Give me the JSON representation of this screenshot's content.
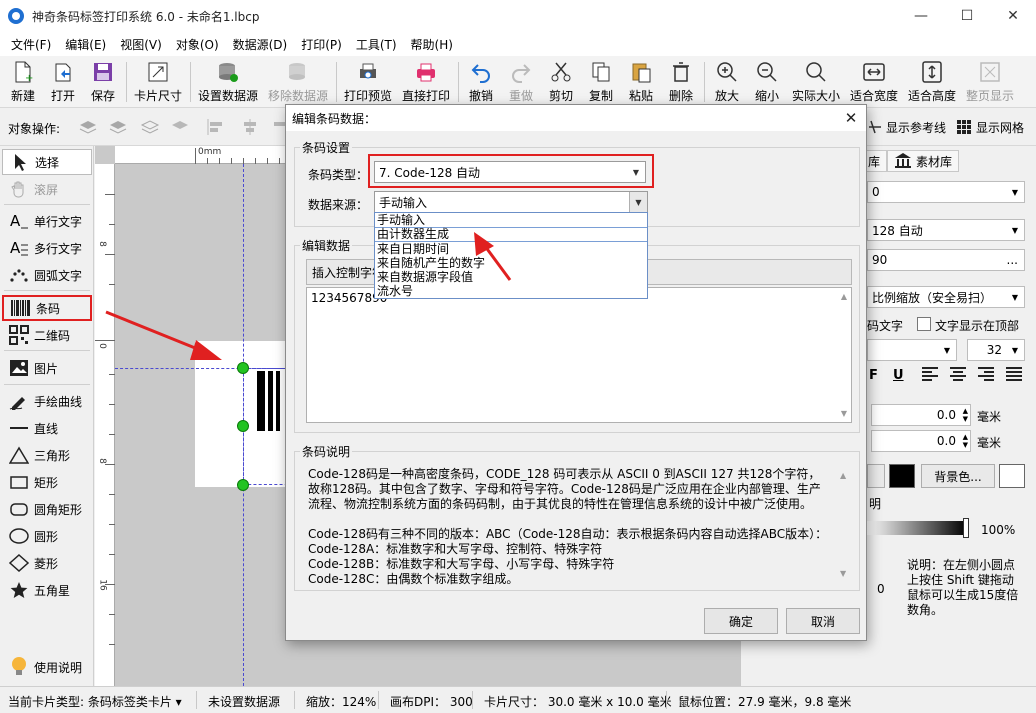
{
  "window": {
    "title": "神奇条码标签打印系统 6.0 - 未命名1.lbcp",
    "minimize": "—",
    "maximize": "☐",
    "close": "✕"
  },
  "menu": [
    "文件(F)",
    "编辑(E)",
    "视图(V)",
    "对象(O)",
    "数据源(D)",
    "打印(P)",
    "工具(T)",
    "帮助(H)"
  ],
  "toolbar": {
    "new": "新建",
    "open": "打开",
    "save": "保存",
    "card_size": "卡片尺寸",
    "set_datasource": "设置数据源",
    "remove_datasource": "移除数据源",
    "print_preview": "打印预览",
    "direct_print": "直接打印",
    "undo": "撤销",
    "redo": "重做",
    "cut": "剪切",
    "copy": "复制",
    "paste": "粘贴",
    "delete": "删除",
    "zoom_in": "放大",
    "zoom_out": "缩小",
    "actual_size": "实际大小",
    "fit_width": "适合宽度",
    "fit_height": "适合高度",
    "fit_page": "整页显示"
  },
  "opsbar": {
    "label": "对象操作:",
    "show_guides": "显示参考线",
    "show_grid": "显示网格"
  },
  "left_tools": {
    "select": "选择",
    "scroll": "滚屏",
    "single_text": "单行文字",
    "multi_text": "多行文字",
    "arc_text": "圆弧文字",
    "barcode": "条码",
    "qrcode": "二维码",
    "image": "图片",
    "freehand": "手绘曲线",
    "line": "直线",
    "triangle": "三角形",
    "rect": "矩形",
    "round_rect": "圆角矩形",
    "circle": "圆形",
    "diamond": "菱形",
    "star": "五角星",
    "help": "使用说明"
  },
  "ruler": {
    "top_zero": "0mm",
    "left_labels": [
      "0",
      "8",
      "8",
      "16"
    ]
  },
  "right_panel": {
    "tab_library": "库",
    "tab_material": "素材库",
    "field_1": "0",
    "field_type": "128 自动",
    "field_value": "90",
    "scale_mode": "比例缩放（安全易扫）",
    "show_text_label": "码文字",
    "text_top_label": "文字显示在顶部",
    "font_size": "32",
    "bold": "F",
    "underline": "U",
    "pos_x": "0.0",
    "pos_y": "0.0",
    "unit": "毫米",
    "bg_color_btn": "背景色...",
    "transparency_label": "明",
    "opacity": "100%",
    "hint": "说明：在左侧小圆点上按住 Shift 键拖动鼠标可以生成15度倍数角。",
    "rotate_value": "0"
  },
  "statusbar": {
    "card_type": "当前卡片类型:  条码标签类卡片 ▾",
    "datasource": "未设置数据源",
    "zoom": "缩放：124%",
    "dpi": "画布DPI：  300",
    "card_size": "卡片尺寸：  30.0 毫米 x 10.0 毫米",
    "mouse_pos": "鼠标位置：27.9 毫米，9.8 毫米"
  },
  "dialog": {
    "title": "编辑条码数据：",
    "close": "✕",
    "group_settings": "条码设置",
    "type_label": "条码类型：",
    "type_value": "7.  Code-128 自动",
    "source_label": "数据来源：",
    "source_value": "手动输入",
    "source_options": [
      "手动输入",
      "由计数器生成",
      "来自日期时间",
      "来自随机产生的数字",
      "来自数据源字段值",
      "流水号"
    ],
    "group_edit": "编辑数据",
    "insert_btn": "插入控制字符",
    "data_value": "1234567890",
    "group_desc": "条码说明",
    "desc_text": "Code-128码是一种高密度条码，CODE_128 码可表示从 ASCII 0 到ASCII 127 共128个字符，故称128码。其中包含了数字、字母和符号字符。Code-128码是广泛应用在企业内部管理、生产流程、物流控制系统方面的条码码制，由于其优良的特性在管理信息系统的设计中被广泛使用。\n\nCode-128码有三种不同的版本：ABC（Code-128自动：表示根据条码内容自动选择ABC版本）：\nCode-128A：标准数字和大写字母、控制符、特殊字符\nCode-128B：标准数字和大写字母、小写字母、特殊字符\nCode-128C：由偶数个标准数字组成。",
    "ok": "确定",
    "cancel": "取消"
  },
  "colors": {
    "accent_red": "#e02020",
    "handle_green": "#22c322",
    "guide_blue": "#4a4ad0"
  }
}
